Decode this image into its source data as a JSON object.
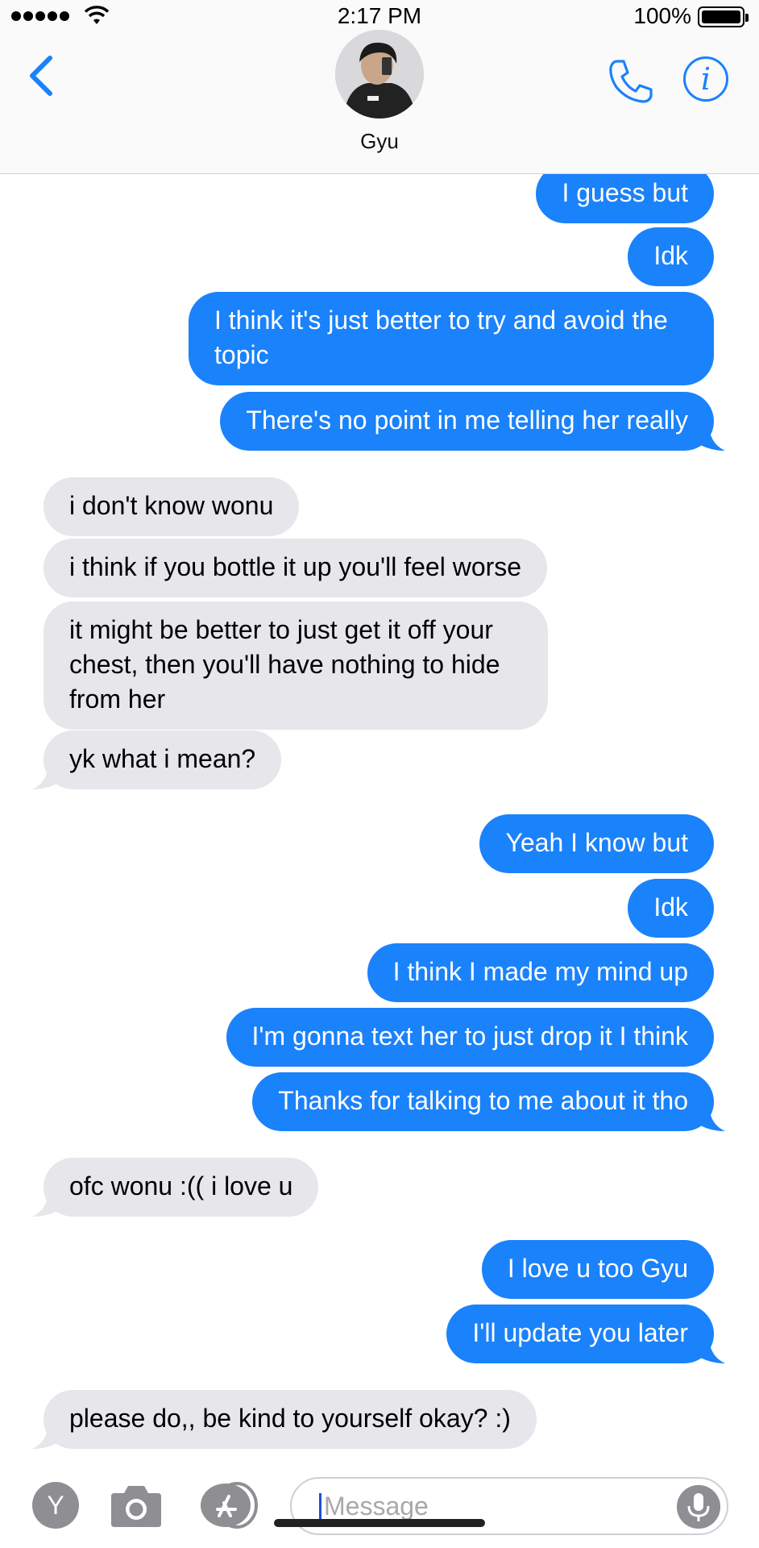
{
  "status_bar": {
    "time": "2:17 PM",
    "battery": "100%"
  },
  "header": {
    "contact_name": "Gyu"
  },
  "messages": [
    {
      "from": "me",
      "text": "I guess but"
    },
    {
      "from": "me",
      "text": "Idk"
    },
    {
      "from": "me",
      "text": "I think it's just better to try and avoid the topic"
    },
    {
      "from": "me",
      "text": "There's no point in me telling her really"
    },
    {
      "from": "them",
      "text": "i don't know wonu"
    },
    {
      "from": "them",
      "text": "i think if you bottle it up you'll feel worse"
    },
    {
      "from": "them",
      "text": "it might be better to just get it off your chest, then you'll have nothing to hide from her"
    },
    {
      "from": "them",
      "text": "yk what i mean?"
    },
    {
      "from": "me",
      "text": "Yeah I know but"
    },
    {
      "from": "me",
      "text": "Idk"
    },
    {
      "from": "me",
      "text": "I think I made my mind up"
    },
    {
      "from": "me",
      "text": "I'm gonna text her to just drop it I think"
    },
    {
      "from": "me",
      "text": "Thanks for talking to me about it tho"
    },
    {
      "from": "them",
      "text": "ofc wonu :(( i love u"
    },
    {
      "from": "me",
      "text": "I love u too Gyu"
    },
    {
      "from": "me",
      "text": "I'll update you later"
    },
    {
      "from": "them",
      "text": "please do,, be kind to yourself okay? :)"
    }
  ],
  "compose": {
    "placeholder": "Message",
    "apps_button_label": "Y"
  },
  "colors": {
    "outgoing_bubble": "#1a82fb",
    "incoming_bubble": "#e6e6eb",
    "accent": "#1a82fb"
  }
}
